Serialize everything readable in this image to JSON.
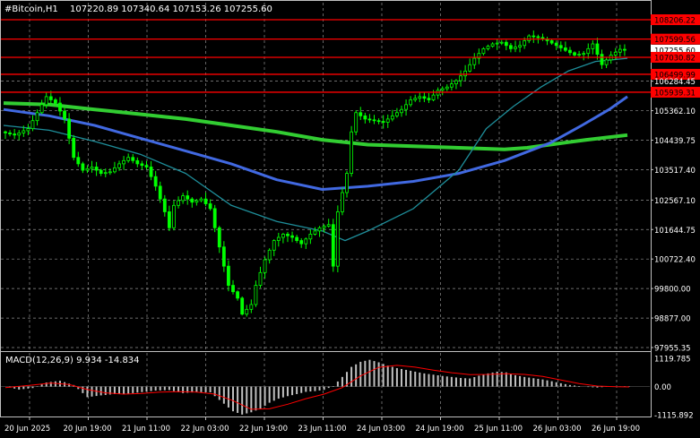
{
  "header": {
    "symbol": "#Bitcoin,H1",
    "ohlc": "107220.89 107340.64 107153.26 107255.60"
  },
  "macd": {
    "label": "MACD(12,26,9) 9.934 -14.834",
    "axis_ticks": [
      {
        "value": 1119.785,
        "label": "1119.785"
      },
      {
        "value": 0,
        "label": "0.00"
      },
      {
        "value": -1115.892,
        "label": "-1115.892"
      }
    ]
  },
  "colors": {
    "background": "#000000",
    "candle": "#00ff00",
    "grid": "#c0c0c0",
    "axis_text": "#ffffff",
    "level_line": "#ff0000",
    "level_label_bg": "#ff0000",
    "ma_fast": "#1e8e9a",
    "ma_mid": "#4169e1",
    "ma_slow": "#32cd32",
    "macd_hist": "#c0c0c0",
    "macd_signal": "#ff0000"
  },
  "chart_data": {
    "type": "candlestick",
    "symbol": "#Bitcoin",
    "timeframe": "H1",
    "y_axis_ticks": [
      {
        "value": 108206.22,
        "label": "108206.22",
        "kind": "level"
      },
      {
        "value": 107599.56,
        "label": "107599.56",
        "kind": "level"
      },
      {
        "value": 107255.6,
        "label": "107255.60",
        "kind": "price"
      },
      {
        "value": 107030.82,
        "label": "107030.82",
        "kind": "level"
      },
      {
        "value": 106499.99,
        "label": "106499.99",
        "kind": "level"
      },
      {
        "value": 106284.45,
        "label": "106284.45",
        "kind": "tick"
      },
      {
        "value": 105939.31,
        "label": "105939.31",
        "kind": "level"
      },
      {
        "value": 105362.1,
        "label": "105362.10",
        "kind": "tick"
      },
      {
        "value": 104439.75,
        "label": "104439.75",
        "kind": "tick"
      },
      {
        "value": 103517.4,
        "label": "103517.40",
        "kind": "tick"
      },
      {
        "value": 102567.1,
        "label": "102567.10",
        "kind": "tick"
      },
      {
        "value": 101644.75,
        "label": "101644.75",
        "kind": "tick"
      },
      {
        "value": 100722.4,
        "label": "100722.40",
        "kind": "tick"
      },
      {
        "value": 99800.0,
        "label": "99800.00",
        "kind": "tick"
      },
      {
        "value": 98877.0,
        "label": "98877.00",
        "kind": "tick"
      },
      {
        "value": 97955.35,
        "label": "97955.35",
        "kind": "tick"
      }
    ],
    "ylim": [
      97955.35,
      108206.22
    ],
    "x_axis_labels": [
      "20 Jun 2025",
      "20 Jun 19:00",
      "21 Jun 11:00",
      "22 Jun 03:00",
      "22 Jun 19:00",
      "23 Jun 11:00",
      "24 Jun 03:00",
      "24 Jun 19:00",
      "25 Jun 11:00",
      "26 Jun 03:00",
      "26 Jun 19:00"
    ],
    "horizontal_levels": [
      108206.22,
      107599.56,
      107030.82,
      106499.99,
      105939.31
    ],
    "close_path": [
      [
        0,
        104700
      ],
      [
        3,
        104600
      ],
      [
        6,
        104800
      ],
      [
        8,
        105300
      ],
      [
        10,
        105800
      ],
      [
        12,
        105600
      ],
      [
        14,
        105100
      ],
      [
        16,
        103900
      ],
      [
        18,
        103500
      ],
      [
        20,
        103600
      ],
      [
        22,
        103400
      ],
      [
        24,
        103450
      ],
      [
        26,
        103700
      ],
      [
        28,
        103900
      ],
      [
        30,
        103700
      ],
      [
        32,
        103600
      ],
      [
        34,
        103000
      ],
      [
        36,
        102200
      ],
      [
        37,
        101700
      ],
      [
        38,
        102400
      ],
      [
        40,
        102700
      ],
      [
        42,
        102500
      ],
      [
        44,
        102600
      ],
      [
        46,
        102300
      ],
      [
        48,
        101100
      ],
      [
        50,
        99900
      ],
      [
        52,
        99500
      ],
      [
        53,
        99000
      ],
      [
        55,
        99300
      ],
      [
        56,
        99900
      ],
      [
        58,
        100700
      ],
      [
        60,
        101300
      ],
      [
        62,
        101500
      ],
      [
        64,
        101400
      ],
      [
        66,
        101200
      ],
      [
        68,
        101500
      ],
      [
        70,
        101700
      ],
      [
        72,
        101800
      ],
      [
        73,
        100500
      ],
      [
        74,
        102200
      ],
      [
        76,
        103400
      ],
      [
        77,
        104700
      ],
      [
        78,
        105300
      ],
      [
        80,
        105100
      ],
      [
        82,
        105050
      ],
      [
        84,
        105000
      ],
      [
        86,
        105200
      ],
      [
        88,
        105400
      ],
      [
        90,
        105700
      ],
      [
        92,
        105800
      ],
      [
        94,
        105700
      ],
      [
        96,
        106000
      ],
      [
        98,
        106100
      ],
      [
        100,
        106300
      ],
      [
        102,
        106600
      ],
      [
        104,
        107000
      ],
      [
        106,
        107300
      ],
      [
        108,
        107450
      ],
      [
        110,
        107500
      ],
      [
        112,
        107300
      ],
      [
        114,
        107400
      ],
      [
        116,
        107700
      ],
      [
        118,
        107650
      ],
      [
        120,
        107550
      ],
      [
        122,
        107400
      ],
      [
        124,
        107250
      ],
      [
        126,
        107100
      ],
      [
        128,
        107150
      ],
      [
        130,
        107450
      ],
      [
        132,
        106800
      ],
      [
        134,
        107100
      ],
      [
        136,
        107280
      ],
      [
        137,
        107255.6
      ]
    ],
    "ma_fast_path": [
      [
        0,
        104900
      ],
      [
        10,
        104750
      ],
      [
        20,
        104400
      ],
      [
        30,
        104000
      ],
      [
        40,
        103400
      ],
      [
        50,
        102400
      ],
      [
        60,
        101900
      ],
      [
        70,
        101600
      ],
      [
        75,
        101300
      ],
      [
        80,
        101600
      ],
      [
        90,
        102300
      ],
      [
        100,
        103500
      ],
      [
        106,
        104800
      ],
      [
        112,
        105500
      ],
      [
        118,
        106100
      ],
      [
        124,
        106600
      ],
      [
        130,
        106900
      ],
      [
        137,
        107000
      ]
    ],
    "ma_mid_path": [
      [
        0,
        105400
      ],
      [
        10,
        105200
      ],
      [
        20,
        104900
      ],
      [
        30,
        104500
      ],
      [
        40,
        104100
      ],
      [
        50,
        103700
      ],
      [
        60,
        103200
      ],
      [
        70,
        102900
      ],
      [
        80,
        103000
      ],
      [
        90,
        103150
      ],
      [
        100,
        103400
      ],
      [
        110,
        103800
      ],
      [
        120,
        104350
      ],
      [
        127,
        104900
      ],
      [
        133,
        105400
      ],
      [
        137,
        105800
      ]
    ],
    "ma_slow_path": [
      [
        0,
        105600
      ],
      [
        10,
        105550
      ],
      [
        20,
        105400
      ],
      [
        30,
        105250
      ],
      [
        40,
        105100
      ],
      [
        50,
        104900
      ],
      [
        60,
        104700
      ],
      [
        70,
        104450
      ],
      [
        80,
        104300
      ],
      [
        90,
        104250
      ],
      [
        100,
        104200
      ],
      [
        110,
        104150
      ],
      [
        115,
        104200
      ],
      [
        120,
        104300
      ],
      [
        128,
        104450
      ],
      [
        137,
        104600
      ]
    ],
    "macd_hist": [
      [
        0,
        0
      ],
      [
        3,
        -120
      ],
      [
        6,
        -60
      ],
      [
        9,
        160
      ],
      [
        12,
        230
      ],
      [
        15,
        60
      ],
      [
        18,
        -420
      ],
      [
        21,
        -350
      ],
      [
        24,
        -300
      ],
      [
        27,
        -280
      ],
      [
        30,
        -220
      ],
      [
        33,
        -160
      ],
      [
        36,
        -140
      ],
      [
        39,
        -260
      ],
      [
        42,
        -220
      ],
      [
        45,
        -230
      ],
      [
        48,
        -680
      ],
      [
        50,
        -980
      ],
      [
        52,
        -1110
      ],
      [
        54,
        -1020
      ],
      [
        56,
        -880
      ],
      [
        58,
        -640
      ],
      [
        60,
        -480
      ],
      [
        62,
        -380
      ],
      [
        64,
        -300
      ],
      [
        66,
        -210
      ],
      [
        68,
        -180
      ],
      [
        70,
        -130
      ],
      [
        72,
        20
      ],
      [
        74,
        380
      ],
      [
        76,
        780
      ],
      [
        78,
        980
      ],
      [
        80,
        1060
      ],
      [
        82,
        960
      ],
      [
        84,
        830
      ],
      [
        86,
        730
      ],
      [
        88,
        660
      ],
      [
        90,
        590
      ],
      [
        92,
        520
      ],
      [
        94,
        470
      ],
      [
        96,
        420
      ],
      [
        98,
        380
      ],
      [
        100,
        340
      ],
      [
        102,
        320
      ],
      [
        104,
        430
      ],
      [
        106,
        520
      ],
      [
        108,
        590
      ],
      [
        110,
        560
      ],
      [
        112,
        450
      ],
      [
        114,
        380
      ],
      [
        116,
        330
      ],
      [
        118,
        280
      ],
      [
        120,
        210
      ],
      [
        122,
        130
      ],
      [
        124,
        60
      ],
      [
        126,
        20
      ],
      [
        128,
        -20
      ],
      [
        130,
        -40
      ],
      [
        132,
        -10
      ],
      [
        134,
        0
      ],
      [
        136,
        10
      ],
      [
        137,
        9.934
      ]
    ],
    "macd_signal": [
      [
        0,
        -40
      ],
      [
        6,
        60
      ],
      [
        10,
        140
      ],
      [
        14,
        80
      ],
      [
        18,
        -120
      ],
      [
        22,
        -250
      ],
      [
        26,
        -300
      ],
      [
        30,
        -270
      ],
      [
        34,
        -220
      ],
      [
        38,
        -200
      ],
      [
        42,
        -220
      ],
      [
        46,
        -300
      ],
      [
        50,
        -560
      ],
      [
        54,
        -900
      ],
      [
        58,
        -880
      ],
      [
        62,
        -700
      ],
      [
        66,
        -480
      ],
      [
        70,
        -300
      ],
      [
        74,
        -40
      ],
      [
        78,
        420
      ],
      [
        82,
        760
      ],
      [
        86,
        840
      ],
      [
        90,
        770
      ],
      [
        94,
        650
      ],
      [
        98,
        550
      ],
      [
        102,
        470
      ],
      [
        106,
        480
      ],
      [
        110,
        510
      ],
      [
        114,
        480
      ],
      [
        118,
        400
      ],
      [
        122,
        260
      ],
      [
        126,
        120
      ],
      [
        130,
        20
      ],
      [
        134,
        -10
      ],
      [
        137,
        -14.834
      ]
    ]
  }
}
